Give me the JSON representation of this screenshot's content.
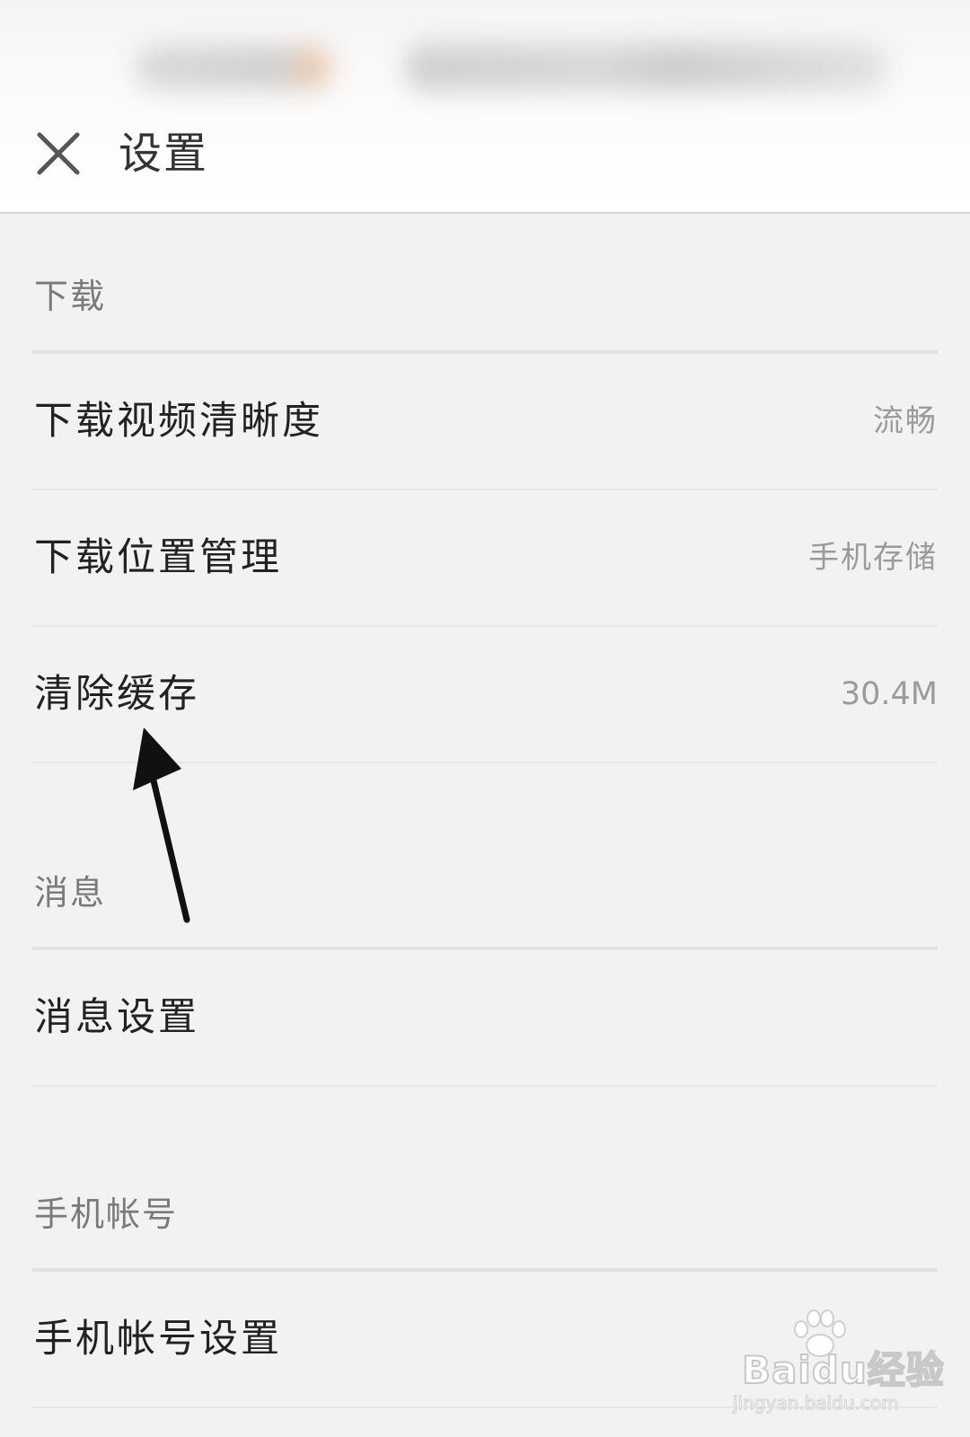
{
  "header": {
    "title": "设置",
    "close_icon": "close-icon"
  },
  "sections": [
    {
      "title": "下载",
      "items": [
        {
          "label": "下载视频清晰度",
          "value": "流畅"
        },
        {
          "label": "下载位置管理",
          "value": "手机存储"
        },
        {
          "label": "清除缓存",
          "value": "30.4M"
        }
      ]
    },
    {
      "title": "消息",
      "items": [
        {
          "label": "消息设置"
        }
      ]
    },
    {
      "title": "手机帐号",
      "items": [
        {
          "label": "手机帐号设置"
        }
      ]
    }
  ],
  "annotation": {
    "type": "arrow",
    "points_to": "清除缓存",
    "color": "#111111"
  },
  "watermark": {
    "brand": "Baidu经验",
    "url": "jingyan.baidu.com"
  },
  "colors": {
    "background": "#f2f2f2",
    "header_background": "#ffffff",
    "label_text": "#222222",
    "section_text": "#7a7a7a",
    "value_text": "#9b9b9b",
    "divider": "#e2e2e2"
  }
}
